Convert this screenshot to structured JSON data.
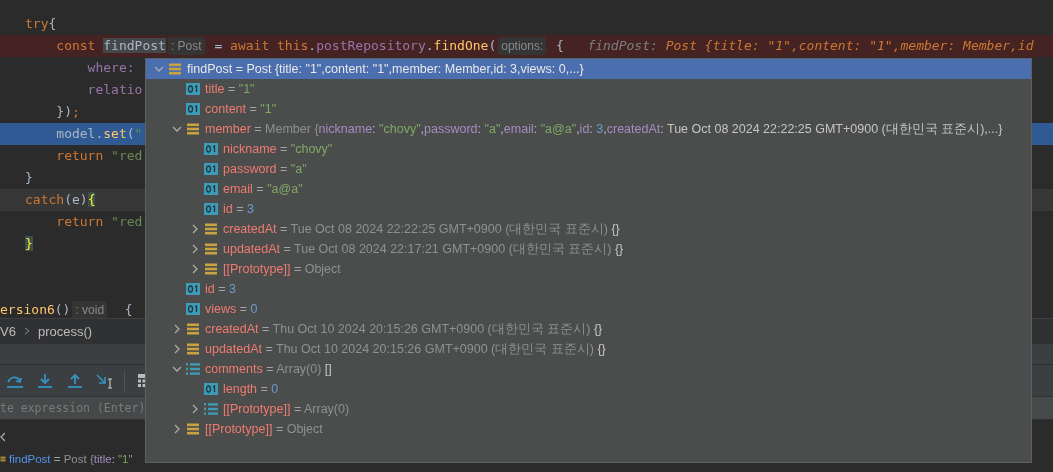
{
  "editor": {
    "lines": [
      {
        "breakpoint": false,
        "execution": false,
        "caret": false,
        "tokens": [
          {
            "kind": "keyword",
            "text": "try"
          },
          {
            "kind": "plain",
            "text": "{"
          }
        ]
      },
      {
        "breakpoint": true,
        "execution": false,
        "caret": false,
        "tokens": [
          {
            "kind": "keyword",
            "text": "    const "
          },
          {
            "kind": "selected-word",
            "text": "findPost"
          },
          {
            "kind": "hint",
            "text": ": Post"
          },
          {
            "kind": "plain",
            "text": " = "
          },
          {
            "kind": "keyword",
            "text": "await this"
          },
          {
            "kind": "plain",
            "text": "."
          },
          {
            "kind": "field",
            "text": "postRepository"
          },
          {
            "kind": "plain",
            "text": "."
          },
          {
            "kind": "method",
            "text": "findOne"
          },
          {
            "kind": "plain",
            "text": "("
          },
          {
            "kind": "hint",
            "text": "options:"
          },
          {
            "kind": "plain",
            "text": " {   "
          },
          {
            "kind": "inline-name",
            "text": "findPost: "
          },
          {
            "kind": "inline-value",
            "text": "Post {title: \"1\",content: \"1\",member: Member,id"
          }
        ]
      },
      {
        "breakpoint": false,
        "execution": false,
        "caret": false,
        "tokens": [
          {
            "kind": "field",
            "text": "        where: "
          }
        ]
      },
      {
        "breakpoint": false,
        "execution": false,
        "caret": false,
        "tokens": [
          {
            "kind": "field",
            "text": "        relatio"
          }
        ]
      },
      {
        "breakpoint": false,
        "execution": false,
        "caret": false,
        "tokens": [
          {
            "kind": "plain",
            "text": "    })"
          },
          {
            "kind": "keyword",
            "text": ";"
          }
        ]
      },
      {
        "breakpoint": false,
        "execution": true,
        "caret": false,
        "tokens": [
          {
            "kind": "plain",
            "text": "    model."
          },
          {
            "kind": "method",
            "text": "set"
          },
          {
            "kind": "plain",
            "text": "("
          },
          {
            "kind": "string",
            "text": "\""
          }
        ]
      },
      {
        "breakpoint": false,
        "execution": false,
        "caret": false,
        "tokens": [
          {
            "kind": "keyword",
            "text": "    return "
          },
          {
            "kind": "string",
            "text": "\"red"
          }
        ]
      },
      {
        "breakpoint": false,
        "execution": false,
        "caret": false,
        "tokens": [
          {
            "kind": "plain",
            "text": "}"
          }
        ]
      },
      {
        "breakpoint": false,
        "execution": false,
        "caret": true,
        "tokens": [
          {
            "kind": "keyword",
            "text": "catch"
          },
          {
            "kind": "plain",
            "text": "(e)"
          },
          {
            "kind": "brace-match",
            "text": "{"
          }
        ]
      },
      {
        "breakpoint": false,
        "execution": false,
        "caret": false,
        "tokens": [
          {
            "kind": "keyword",
            "text": "    return "
          },
          {
            "kind": "string",
            "text": "\"red"
          }
        ]
      },
      {
        "breakpoint": false,
        "execution": false,
        "caret": false,
        "tokens": [
          {
            "kind": "brace-match",
            "text": "}"
          }
        ]
      },
      {
        "breakpoint": false,
        "execution": false,
        "caret": false
      },
      {
        "breakpoint": false,
        "execution": false,
        "caret": false
      }
    ],
    "sticky_line": [
      {
        "kind": "method",
        "text": "ersion6"
      },
      {
        "kind": "plain",
        "text": "()"
      },
      {
        "kind": "hint",
        "text": ": void"
      },
      {
        "kind": "plain",
        "text": "  {"
      }
    ]
  },
  "breadcrumb": [
    "V6",
    "process()"
  ],
  "toolbar": [
    {
      "kind": "step-over"
    },
    {
      "kind": "step-into"
    },
    {
      "kind": "step-out"
    },
    {
      "kind": "run-to-cursor"
    },
    {
      "kind": "divider"
    },
    {
      "kind": "evaluate"
    }
  ],
  "evaluate_field": {
    "placeholder": "te expression (Enter)"
  },
  "variables": [
    {
      "name": "findPost",
      "kind": "object",
      "value": [
        {
          "kind": "eq",
          "text": " = "
        },
        {
          "kind": "dim",
          "text": "Post {"
        },
        {
          "kind": "key",
          "text": "title"
        },
        {
          "kind": "text",
          "text": ": "
        },
        {
          "kind": "str",
          "text": "\"1\""
        }
      ]
    }
  ],
  "popup": {
    "root": {
      "name": "findPost",
      "kind": "object",
      "expanded": true,
      "selected": true,
      "value": " = Post {title: \"1\",content: \"1\",member: Member,id: 3,views: 0,...}",
      "children": [
        {
          "name": "title",
          "kind": "primitive",
          "value": [
            {
              "kind": "eq",
              "text": " = "
            },
            {
              "kind": "str",
              "text": "\"1\""
            }
          ]
        },
        {
          "name": "content",
          "kind": "primitive",
          "value": [
            {
              "kind": "eq",
              "text": " = "
            },
            {
              "kind": "str",
              "text": "\"1\""
            }
          ]
        },
        {
          "name": "member",
          "kind": "object",
          "expanded": true,
          "value": [
            {
              "kind": "eq",
              "text": " = "
            },
            {
              "kind": "dim",
              "text": "Member {"
            },
            {
              "kind": "key",
              "text": "nickname"
            },
            {
              "kind": "text",
              "text": ": "
            },
            {
              "kind": "str",
              "text": "\"chovy\""
            },
            {
              "kind": "text",
              "text": ","
            },
            {
              "kind": "key",
              "text": "password"
            },
            {
              "kind": "text",
              "text": ": "
            },
            {
              "kind": "str",
              "text": "\"a\""
            },
            {
              "kind": "text",
              "text": ","
            },
            {
              "kind": "key",
              "text": "email"
            },
            {
              "kind": "text",
              "text": ": "
            },
            {
              "kind": "str",
              "text": "\"a@a\""
            },
            {
              "kind": "text",
              "text": ","
            },
            {
              "kind": "key",
              "text": "id"
            },
            {
              "kind": "text",
              "text": ": "
            },
            {
              "kind": "num",
              "text": "3"
            },
            {
              "kind": "text",
              "text": ","
            },
            {
              "kind": "key",
              "text": "createdAt"
            },
            {
              "kind": "light",
              "text": ": Tue Oct 08 2024 22:22:25 GMT+0900 (대한민국 표준시),...}"
            }
          ],
          "children": [
            {
              "name": "nickname",
              "kind": "primitive",
              "value": [
                {
                  "kind": "eq",
                  "text": " = "
                },
                {
                  "kind": "str",
                  "text": "\"chovy\""
                }
              ]
            },
            {
              "name": "password",
              "kind": "primitive",
              "value": [
                {
                  "kind": "eq",
                  "text": " = "
                },
                {
                  "kind": "str",
                  "text": "\"a\""
                }
              ]
            },
            {
              "name": "email",
              "kind": "primitive",
              "value": [
                {
                  "kind": "eq",
                  "text": " = "
                },
                {
                  "kind": "str",
                  "text": "\"a@a\""
                }
              ]
            },
            {
              "name": "id",
              "kind": "primitive",
              "value": [
                {
                  "kind": "eq",
                  "text": " = "
                },
                {
                  "kind": "num",
                  "text": "3"
                }
              ]
            },
            {
              "name": "createdAt",
              "kind": "object",
              "expanded": false,
              "value": [
                {
                  "kind": "eq",
                  "text": " = "
                },
                {
                  "kind": "dim",
                  "text": "Tue Oct 08 2024 22:22:25 GMT+0900 (대한민국 표준시) "
                },
                {
                  "kind": "light",
                  "text": "{}"
                }
              ]
            },
            {
              "name": "updatedAt",
              "kind": "object",
              "expanded": false,
              "value": [
                {
                  "kind": "eq",
                  "text": " = "
                },
                {
                  "kind": "dim",
                  "text": "Tue Oct 08 2024 22:17:21 GMT+0900 (대한민국 표준시) "
                },
                {
                  "kind": "light",
                  "text": "{}"
                }
              ]
            },
            {
              "name": "[[Prototype]]",
              "kind": "object",
              "expanded": false,
              "value": [
                {
                  "kind": "eq",
                  "text": " = "
                },
                {
                  "kind": "dim",
                  "text": "Object"
                }
              ]
            }
          ]
        },
        {
          "name": "id",
          "kind": "primitive",
          "value": [
            {
              "kind": "eq",
              "text": " = "
            },
            {
              "kind": "num",
              "text": "3"
            }
          ]
        },
        {
          "name": "views",
          "kind": "primitive",
          "value": [
            {
              "kind": "eq",
              "text": " = "
            },
            {
              "kind": "num",
              "text": "0"
            }
          ]
        },
        {
          "name": "createdAt",
          "kind": "object",
          "expanded": false,
          "value": [
            {
              "kind": "eq",
              "text": " = "
            },
            {
              "kind": "dim",
              "text": "Thu Oct 10 2024 20:15:26 GMT+0900 (대한민국 표준시) "
            },
            {
              "kind": "light",
              "text": "{}"
            }
          ]
        },
        {
          "name": "updatedAt",
          "kind": "object",
          "expanded": false,
          "value": [
            {
              "kind": "eq",
              "text": " = "
            },
            {
              "kind": "dim",
              "text": "Thu Oct 10 2024 20:15:26 GMT+0900 (대한민국 표준시) "
            },
            {
              "kind": "light",
              "text": "{}"
            }
          ]
        },
        {
          "name": "comments",
          "kind": "array",
          "expanded": true,
          "value": [
            {
              "kind": "eq",
              "text": " = "
            },
            {
              "kind": "dim",
              "text": "Array(0) "
            },
            {
              "kind": "light",
              "text": "[]"
            }
          ],
          "children": [
            {
              "name": "length",
              "kind": "primitive",
              "value": [
                {
                  "kind": "eq",
                  "text": " = "
                },
                {
                  "kind": "num",
                  "text": "0"
                }
              ]
            },
            {
              "name": "[[Prototype]]",
              "kind": "array",
              "expanded": false,
              "value": [
                {
                  "kind": "eq",
                  "text": " = "
                },
                {
                  "kind": "dim",
                  "text": "Array(0)"
                }
              ]
            }
          ]
        },
        {
          "name": "[[Prototype]]",
          "kind": "object",
          "expanded": false,
          "value": [
            {
              "kind": "eq",
              "text": " = "
            },
            {
              "kind": "dim",
              "text": "Object"
            }
          ]
        }
      ]
    }
  }
}
